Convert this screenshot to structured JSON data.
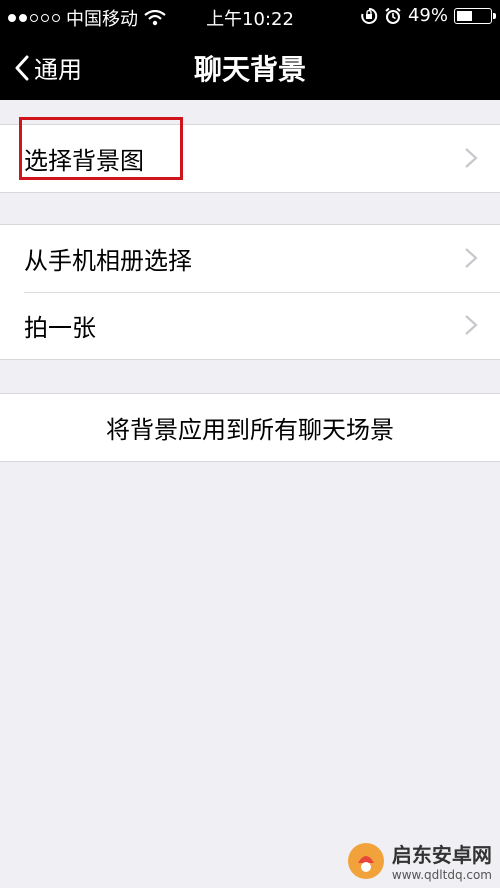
{
  "status_bar": {
    "carrier": "中国移动",
    "time": "上午10:22",
    "battery_pct": "49%",
    "battery_level": 0.49,
    "signal_dots_filled": 2,
    "signal_dots_total": 5,
    "icons": [
      "wifi-icon",
      "rotation-lock-icon",
      "alarm-icon",
      "battery-icon"
    ]
  },
  "nav": {
    "back_label": "通用",
    "title": "聊天背景"
  },
  "groups": [
    {
      "items": [
        {
          "label": "选择背景图",
          "chevron": true
        }
      ]
    },
    {
      "items": [
        {
          "label": "从手机相册选择",
          "chevron": true
        },
        {
          "label": "拍一张",
          "chevron": true
        }
      ]
    },
    {
      "items": [
        {
          "label": "将背景应用到所有聊天场景",
          "chevron": false
        }
      ]
    }
  ],
  "watermark": {
    "name": "启东安卓网",
    "url": "www.qdltdq.com"
  },
  "colors": {
    "nav_bg": "#000000",
    "page_bg": "#efeff4",
    "highlight": "#d0141c"
  }
}
